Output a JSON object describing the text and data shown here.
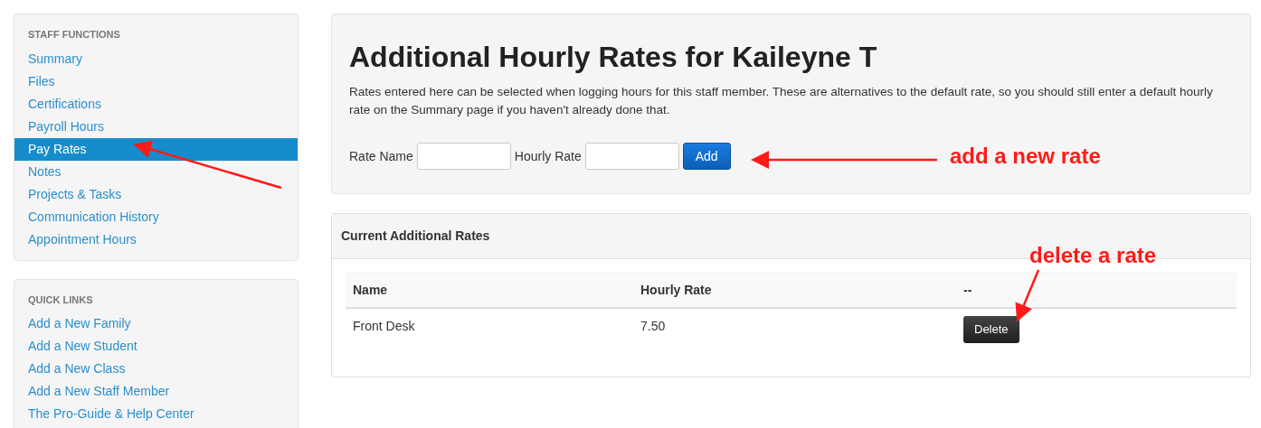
{
  "sidebar": {
    "sections": [
      {
        "heading": "STAFF FUNCTIONS",
        "items": [
          {
            "label": "Summary",
            "selected": false
          },
          {
            "label": "Files",
            "selected": false
          },
          {
            "label": "Certifications",
            "selected": false
          },
          {
            "label": "Payroll Hours",
            "selected": false
          },
          {
            "label": "Pay Rates",
            "selected": true
          },
          {
            "label": "Notes",
            "selected": false
          },
          {
            "label": "Projects & Tasks",
            "selected": false
          },
          {
            "label": "Communication History",
            "selected": false
          },
          {
            "label": "Appointment Hours",
            "selected": false
          }
        ]
      },
      {
        "heading": "QUICK LINKS",
        "items": [
          {
            "label": "Add a New Family",
            "selected": false
          },
          {
            "label": "Add a New Student",
            "selected": false
          },
          {
            "label": "Add a New Class",
            "selected": false
          },
          {
            "label": "Add a New Staff Member",
            "selected": false
          },
          {
            "label": "The Pro-Guide & Help Center",
            "selected": false
          }
        ]
      }
    ]
  },
  "header": {
    "title": "Additional Hourly Rates for Kaileyne T",
    "description": "Rates entered here can be selected when logging hours for this staff member. These are alternatives to the default rate, so you should still enter a default hourly rate on the Summary page if you haven't already done that.",
    "form": {
      "fields": [
        {
          "label": "Rate Name"
        },
        {
          "label": "Hourly Rate"
        }
      ],
      "button": "Add"
    }
  },
  "rates_panel": {
    "title": "Current Additional Rates",
    "columns": [
      "Name",
      "Hourly Rate",
      "--"
    ],
    "rows": [
      {
        "name": "Front Desk",
        "rate": "7.50",
        "action": "Delete"
      }
    ]
  },
  "annotations": [
    {
      "text": "add a new rate"
    },
    {
      "text": "delete a rate"
    }
  ]
}
